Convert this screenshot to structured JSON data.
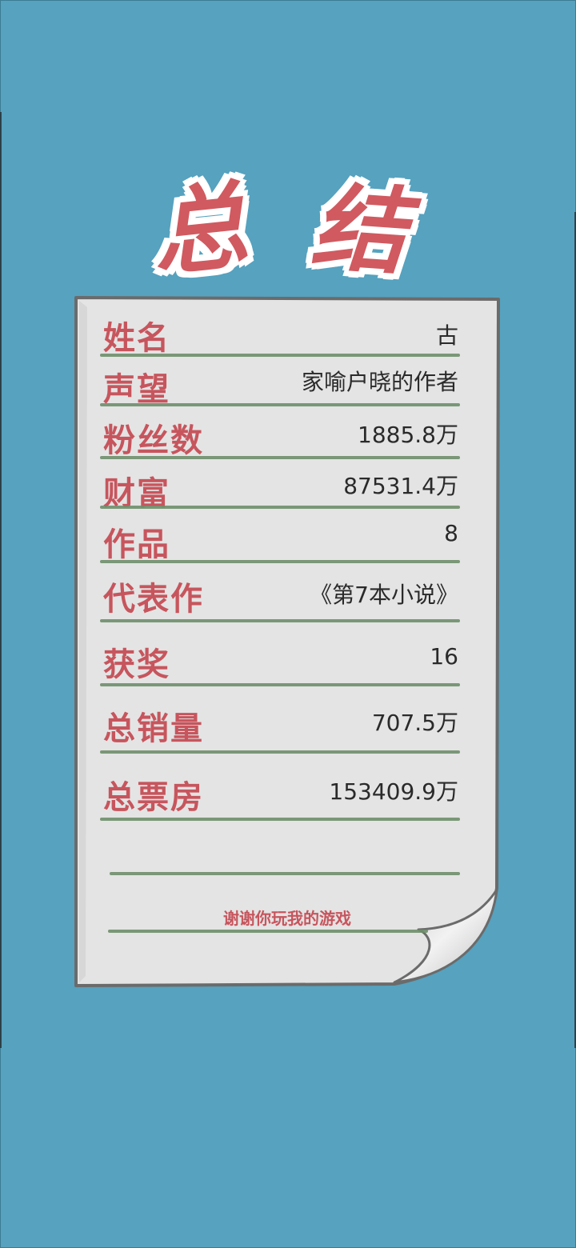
{
  "title": {
    "char1": "总",
    "char2": "结"
  },
  "summary": {
    "rows": [
      {
        "label": "姓名",
        "value": "古"
      },
      {
        "label": "声望",
        "value": "家喻户晓的作者"
      },
      {
        "label": "粉丝数",
        "value": "1885.8万"
      },
      {
        "label": "财富",
        "value": "87531.4万"
      },
      {
        "label": "作品",
        "value": "8"
      },
      {
        "label": "代表作",
        "value": "《第7本小说》"
      },
      {
        "label": "获奖",
        "value": "16"
      },
      {
        "label": "总销量",
        "value": "707.5万"
      },
      {
        "label": "总票房",
        "value": "153409.9万"
      }
    ],
    "thanks": "谢谢你玩我的游戏"
  },
  "colors": {
    "background": "#56a2bf",
    "paper": "#e4e4e4",
    "label": "#c7555d",
    "line": "#6e8e6a",
    "value": "#2a2a2a"
  }
}
